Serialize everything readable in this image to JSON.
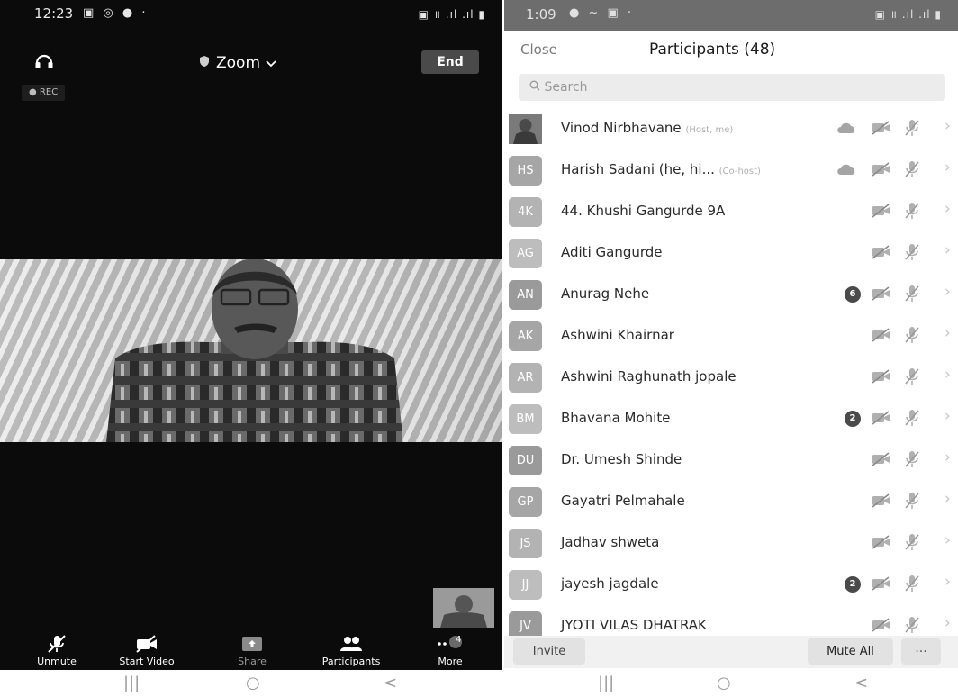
{
  "left_screen": {
    "status_bar": {
      "time": "12:23",
      "icons": "▣ ◎ ● ·",
      "right_icons": "▣ ॥ .ıl .ıl ▮"
    },
    "app_title": "Zoom",
    "end_label": "End",
    "rec_label": "REC",
    "toolbar": [
      {
        "name": "unmute",
        "label": "Unmute"
      },
      {
        "name": "start-video",
        "label": "Start Video"
      },
      {
        "name": "share",
        "label": "Share"
      },
      {
        "name": "participants",
        "label": "Participants"
      },
      {
        "name": "more",
        "label": "More",
        "badge": "4"
      }
    ]
  },
  "right_screen": {
    "status_bar": {
      "time": "1:09",
      "icons": "● ~ ▣ ·",
      "right_icons": "▣ ॥ .ıl .ıl ▮"
    },
    "close_label": "Close",
    "title": "Participants (48)",
    "search_placeholder": "Search",
    "participants": [
      {
        "initials": "",
        "name": "Vinod Nirbhavane",
        "role": "(Host, me)",
        "badge": "",
        "cloud": true,
        "photo": true
      },
      {
        "initials": "HS",
        "name": "Harish Sadani (he, hi...",
        "role": "(Co-host)",
        "badge": "",
        "cloud": true
      },
      {
        "initials": "4K",
        "name": "44. Khushi Gangurde 9A",
        "role": "",
        "badge": ""
      },
      {
        "initials": "AG",
        "name": "Aditi Gangurde",
        "role": "",
        "badge": ""
      },
      {
        "initials": "AN",
        "name": "Anurag Nehe",
        "role": "",
        "badge": "6"
      },
      {
        "initials": "AK",
        "name": "Ashwini Khairnar",
        "role": "",
        "badge": ""
      },
      {
        "initials": "AR",
        "name": "Ashwini Raghunath jopale",
        "role": "",
        "badge": ""
      },
      {
        "initials": "BM",
        "name": "Bhavana Mohite",
        "role": "",
        "badge": "2"
      },
      {
        "initials": "DU",
        "name": "Dr. Umesh Shinde",
        "role": "",
        "badge": ""
      },
      {
        "initials": "GP",
        "name": "Gayatri Pelmahale",
        "role": "",
        "badge": ""
      },
      {
        "initials": "JS",
        "name": "Jadhav shweta",
        "role": "",
        "badge": ""
      },
      {
        "initials": "JJ",
        "name": "jayesh jagdale",
        "role": "",
        "badge": "2"
      },
      {
        "initials": "JV",
        "name": "JYOTI VILAS DHATRAK",
        "role": "",
        "badge": ""
      }
    ],
    "invite_label": "Invite",
    "mute_all_label": "Mute All",
    "more_label": "···"
  },
  "nav": {
    "recents": "|||",
    "home": "○",
    "back": "<"
  }
}
